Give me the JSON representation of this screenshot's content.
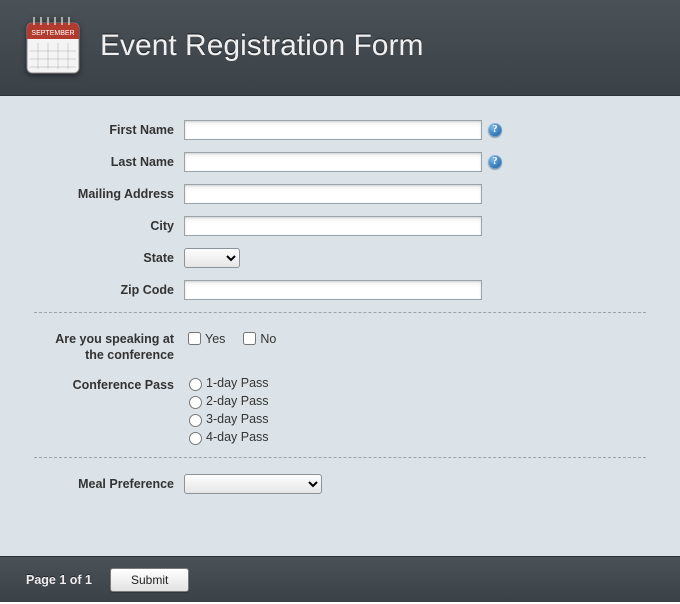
{
  "header": {
    "title": "Event Registration Form"
  },
  "fields": {
    "first_name": {
      "label": "First Name",
      "value": "",
      "help": "?"
    },
    "last_name": {
      "label": "Last Name",
      "value": "",
      "help": "?"
    },
    "mailing_address": {
      "label": "Mailing Address",
      "value": ""
    },
    "city": {
      "label": "City",
      "value": ""
    },
    "state": {
      "label": "State",
      "value": ""
    },
    "zip_code": {
      "label": "Zip Code",
      "value": ""
    }
  },
  "speaking": {
    "label": "Are you speaking at the conference",
    "yes": "Yes",
    "no": "No"
  },
  "pass": {
    "label": "Conference Pass",
    "opt1": "1-day Pass",
    "opt2": "2-day Pass",
    "opt3": "3-day Pass",
    "opt4": "4-day Pass"
  },
  "meal": {
    "label": "Meal Preference",
    "value": ""
  },
  "footer": {
    "page": "Page 1 of 1",
    "submit": "Submit"
  }
}
